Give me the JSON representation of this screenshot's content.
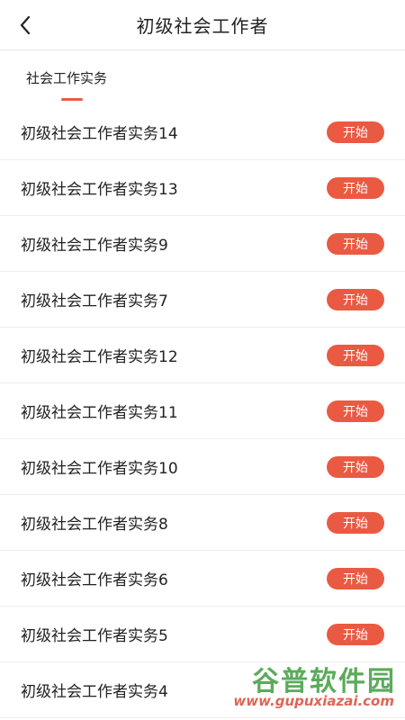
{
  "header": {
    "title": "初级社会工作者",
    "back_icon": "chevron-left-icon"
  },
  "tabs": [
    {
      "label": "社会工作实务",
      "active": true
    }
  ],
  "accent_color": "#ea5a43",
  "list": {
    "items": [
      {
        "label": "初级社会工作者实务14",
        "button": "开始"
      },
      {
        "label": "初级社会工作者实务13",
        "button": "开始"
      },
      {
        "label": "初级社会工作者实务9",
        "button": "开始"
      },
      {
        "label": "初级社会工作者实务7",
        "button": "开始"
      },
      {
        "label": "初级社会工作者实务12",
        "button": "开始"
      },
      {
        "label": "初级社会工作者实务11",
        "button": "开始"
      },
      {
        "label": "初级社会工作者实务10",
        "button": "开始"
      },
      {
        "label": "初级社会工作者实务8",
        "button": "开始"
      },
      {
        "label": "初级社会工作者实务6",
        "button": "开始"
      },
      {
        "label": "初级社会工作者实务5",
        "button": "开始"
      },
      {
        "label": "初级社会工作者实务4",
        "button": "开始"
      }
    ]
  },
  "watermark": {
    "brand": "谷普软件园",
    "url": "www.gupuxiazai.com"
  }
}
